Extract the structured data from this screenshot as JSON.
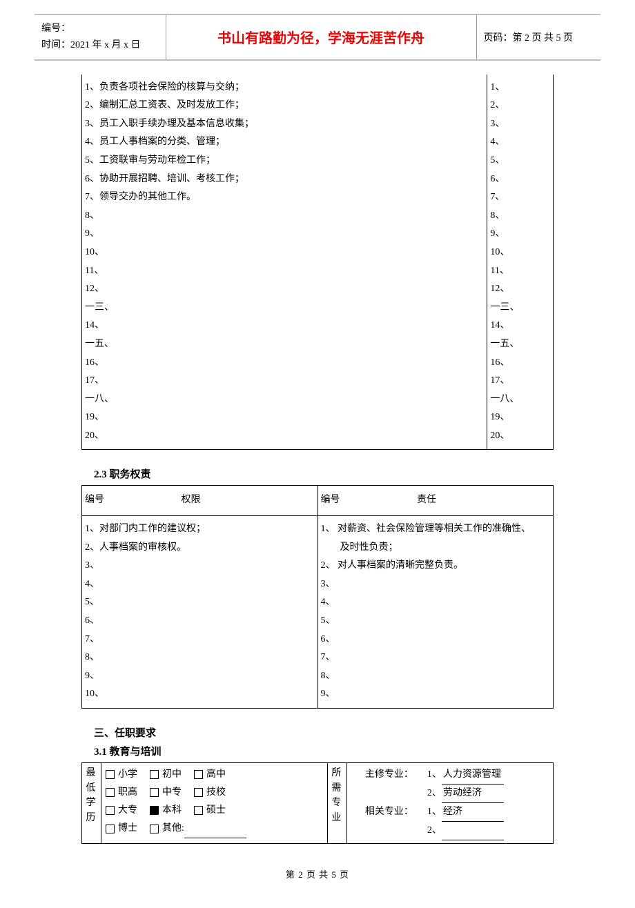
{
  "header": {
    "id_label": "编号：",
    "time_label": "时间：2021 年 x 月 x 日",
    "title": "书山有路勤为径，学海无涯苦作舟",
    "page_label": "页码：第 2 页 共 5 页"
  },
  "table1": {
    "left": [
      "1、负责各项社会保险的核算与交纳；",
      "2、编制汇总工资表、及时发放工作；",
      "3、员工入职手续办理及基本信息收集；",
      "4、员工人事档案的分类、管理；",
      "5、工资联审与劳动年检工作；",
      "6、协助开展招聘、培训、考核工作；",
      "7、领导交办的其他工作。",
      "8、",
      "9、",
      "10、",
      "11、",
      "12、",
      "一三、",
      "14、",
      "一五、",
      "16、",
      "17、",
      "一八、",
      "19、",
      "20、",
      ""
    ],
    "right": [
      "1、",
      "2、",
      "3、",
      "4、",
      "5、",
      "6、",
      "7、",
      "8、",
      "9、",
      "10、",
      "11、",
      "12、",
      "一三、",
      "14、",
      "一五、",
      "16、",
      "17、",
      "一八、",
      "19、",
      "20、",
      ""
    ]
  },
  "section2_3": "2.3  职务权责",
  "auth": {
    "hdr_num1": "编号",
    "hdr_col1": "权限",
    "hdr_num2": "编号",
    "hdr_col2": "责任",
    "left": [
      "1、对部门内工作的建议权；",
      "2、人事档案的审核权。",
      "3、",
      "4、",
      "5、",
      "6、",
      "7、",
      "8、",
      "9、",
      "10、"
    ],
    "right": [
      "1、 对薪资、社会保险管理等相关工作的准确性、",
      "　　及时性负责；",
      "2、 对人事档案的清晰完整负责。",
      "3、",
      "4、",
      "5、",
      "6、",
      "7、",
      "8、",
      "9、"
    ]
  },
  "section3": "三、任职要求",
  "section3_1": "3.1  教育与培训",
  "edu": {
    "left_label": "最低学历",
    "row1": [
      "小学",
      "初中",
      "高中"
    ],
    "row2": [
      "职高",
      "中专",
      "技校"
    ],
    "row3": [
      "大专",
      "本科",
      "硕士"
    ],
    "row4_a": "博士",
    "row4_b": "其他:",
    "checked": "本科",
    "right_label": "所需专业",
    "major_label": "主修专业：",
    "major_vals": [
      "1、人力资源管理",
      "2、劳动经济　　"
    ],
    "related_label": "相关专业：",
    "related_vals": [
      "1、经济　　　　",
      "2、　　　　　　"
    ]
  },
  "footer": "第 2 页 共 5 页"
}
